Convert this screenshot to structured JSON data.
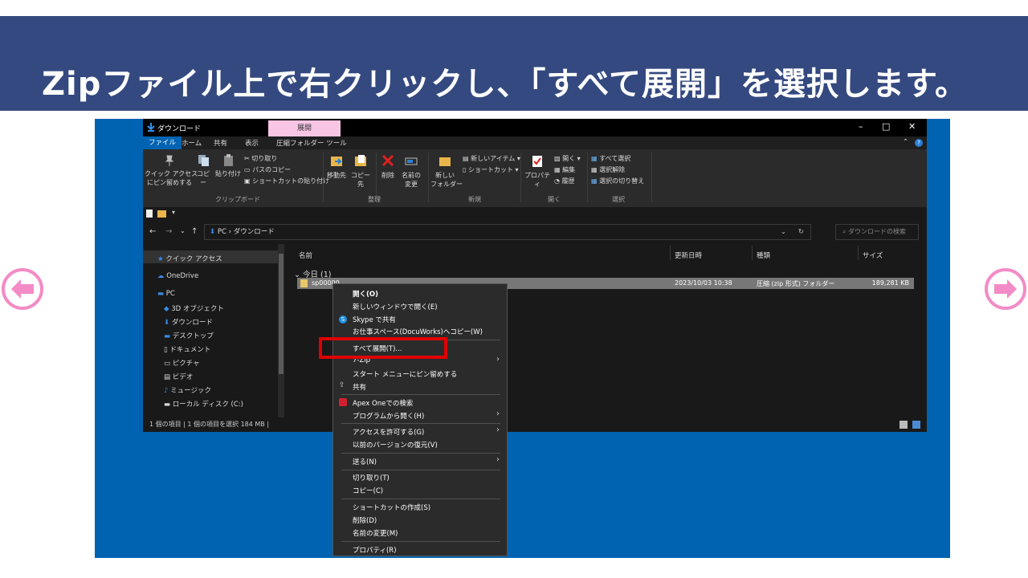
{
  "banner": {
    "text": "Zipファイル上で右クリックし、「すべて展開」を選択します。",
    "bg": "#34497f"
  },
  "window": {
    "title": "ダウンロード",
    "context_tab": "展開",
    "tabs": [
      "ファイル",
      "ホーム",
      "共有",
      "表示",
      "圧縮フォルダー ツール"
    ],
    "ribbon": {
      "pin_label": "クイック アクセス\nにピン留めする",
      "copy_label": "コピー",
      "paste_label": "貼り付け",
      "cut_label": "切り取り",
      "copy_path_label": "パスのコピー",
      "paste_shortcut_label": "ショートカットの貼り付け",
      "clipboard_group": "クリップボード",
      "move_label": "移動先",
      "copyto_label": "コピー先",
      "delete_label": "削除",
      "rename_label": "名前の\n変更",
      "organize_group": "整理",
      "new_folder_label": "新しい\nフォルダー",
      "new_item_label": "新しいアイテム ▾",
      "shortcut_label": "ショートカット ▾",
      "new_group": "新規",
      "properties_label": "プロパティ",
      "open_label": "開く ▾",
      "edit_label": "編集",
      "history_label": "履歴",
      "open_group": "開く",
      "select_all_label": "すべて選択",
      "select_none_label": "選択解除",
      "invert_label": "選択の切り替え",
      "select_group": "選択"
    },
    "address": "PC  ›  ダウンロード",
    "search_placeholder": "ダウンロードの検索",
    "nav": [
      "クイック アクセス",
      "OneDrive",
      "PC",
      "3D オブジェクト",
      "ダウンロード",
      "デスクトップ",
      "ドキュメント",
      "ピクチャ",
      "ビデオ",
      "ミュージック",
      "ローカル ディスク (C:)"
    ],
    "columns": {
      "name": "名前",
      "date": "更新日時",
      "type": "種類",
      "size": "サイズ"
    },
    "group_label": "今日 (1)",
    "file": {
      "name": "sp00000...",
      "date": "2023/10/03 10:38",
      "type": "圧縮 (zip 形式) フォルダー",
      "size": "189,281 KB"
    },
    "status": "1 個の項目  |  1 個の項目を選択  184 MB  |"
  },
  "context_menu": {
    "items": [
      "開く(O)",
      "新しいウィンドウで開く(E)",
      "Skype で共有",
      "お仕事スペース(DocuWorks)へコピー(W)",
      "すべて展開(T)...",
      "7-Zip",
      "スタート メニューにピン留めする",
      "共有",
      "Apex Oneでの検索",
      "プログラムから開く(H)",
      "アクセスを許可する(G)",
      "以前のバージョンの復元(V)",
      "送る(N)",
      "切り取り(T)",
      "コピー(C)",
      "ショートカットの作成(S)",
      "削除(D)",
      "名前の変更(M)",
      "プロパティ(R)"
    ],
    "highlight_color": "#e00000"
  }
}
